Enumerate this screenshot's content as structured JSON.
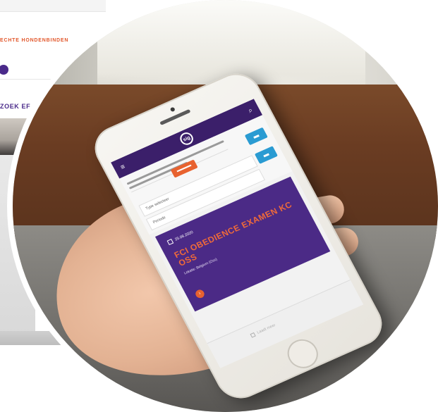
{
  "background_site": {
    "nav_text": "ECHTE HONDENBINDEN",
    "section_text": "ZOEK EF"
  },
  "app": {
    "logo_text": "sig",
    "filters": {
      "select_type_placeholder": "Type selecteer",
      "select_period_placeholder": "Periode"
    },
    "event": {
      "date": "25.08.2020",
      "title": "FCI OBEDIENCE EXAMEN KC OSS",
      "location": "Lokatie: Belgium (Oss)"
    },
    "footer_text": "Laadt meer"
  },
  "colors": {
    "brand_purple": "#4b2a86",
    "accent_orange": "#e8622f",
    "accent_blue": "#2a9bd2"
  }
}
